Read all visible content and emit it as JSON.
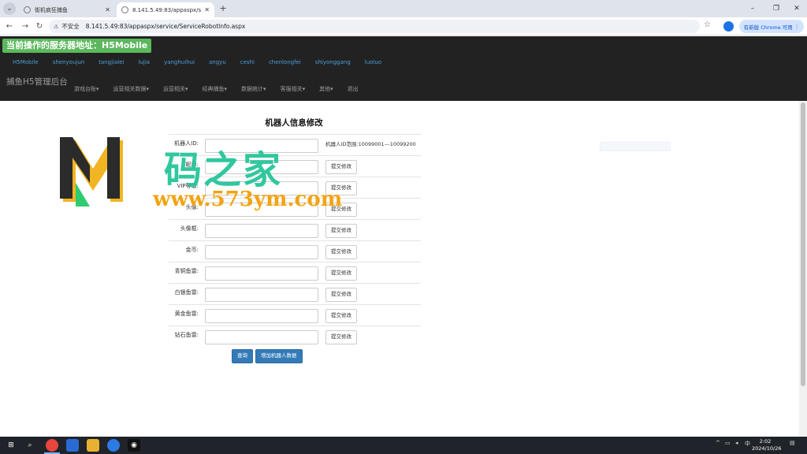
{
  "browser": {
    "tabs": [
      {
        "title": "街机疯狂捕鱼",
        "active": false
      },
      {
        "title": "8.141.5.49:83/appaspx/servic",
        "active": true
      }
    ],
    "new_tab": "+",
    "url_warning": "不安全",
    "url": "8.141.5.49:83/appaspx/service/ServiceRobotInfo.aspx",
    "update_button": "有新版 Chrome 可用"
  },
  "header": {
    "server_title": "当前操作的服务器地址：H5Mobile",
    "servers": [
      "H5Mobile",
      "shenyoujun",
      "tangjialei",
      "lujia",
      "yanghuihui",
      "angyu",
      "ceshi",
      "chenlongfei",
      "shiyonggang",
      "luoluo"
    ],
    "brand": "捕鱼H5管理后台",
    "menu": [
      "游戏台账▾",
      "运营相关数据▾",
      "运营相关▾",
      "经典捕鱼▾",
      "数据统计▾",
      "客服相关▾",
      "其他▾",
      "退出"
    ]
  },
  "form": {
    "title": "机器人信息修改",
    "rows": [
      {
        "label": "机器人ID:",
        "hint": "机器人ID范围:10099001---10099200"
      },
      {
        "label": "昵称:",
        "button": "提交修改"
      },
      {
        "label": "VIP等级:",
        "button": "提交修改"
      },
      {
        "label": "头像:",
        "button": "提交修改"
      },
      {
        "label": "头像框:",
        "button": "提交修改"
      },
      {
        "label": "金币:",
        "button": "提交修改"
      },
      {
        "label": "青铜鱼雷:",
        "button": "提交修改"
      },
      {
        "label": "白银鱼雷:",
        "button": "提交修改"
      },
      {
        "label": "黄金鱼雷:",
        "button": "提交修改"
      },
      {
        "label": "钻石鱼雷:",
        "button": "提交修改"
      }
    ],
    "query_button": "查询",
    "add_button": "增加机器人数据"
  },
  "watermark": {
    "cn_text": "码之家",
    "url": "www.573ym.com"
  },
  "taskbar": {
    "time": "2:02",
    "date": "2024/10/26",
    "ime": "中"
  }
}
